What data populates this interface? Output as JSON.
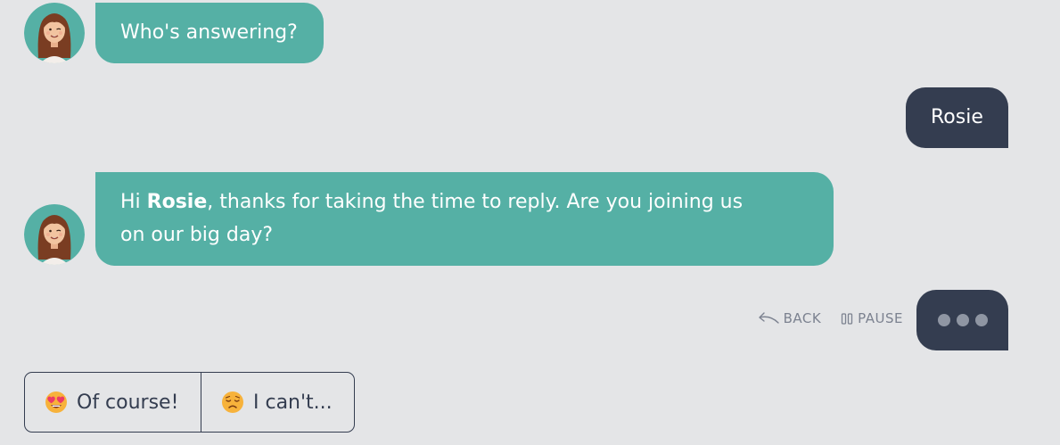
{
  "messages": [
    {
      "sender": "bot",
      "text": "Who's answering?"
    },
    {
      "sender": "user",
      "text": "Rosie"
    },
    {
      "sender": "bot",
      "line1_prefix": "Hi ",
      "line1_name": "Rosie",
      "line1_suffix": ", thanks for taking the time to reply. Are you joining us",
      "line2": "on our big day?"
    }
  ],
  "controls": {
    "back_label": "BACK",
    "pause_label": "PAUSE"
  },
  "choices": [
    {
      "emoji": "heart-eyes-emoji",
      "label": "Of course!"
    },
    {
      "emoji": "disappointed-emoji",
      "label": "I can't..."
    }
  ],
  "colors": {
    "background": "#e4e5e7",
    "bot_bubble": "#55b0a5",
    "user_bubble": "#343d50",
    "control_text": "#7c8290"
  }
}
